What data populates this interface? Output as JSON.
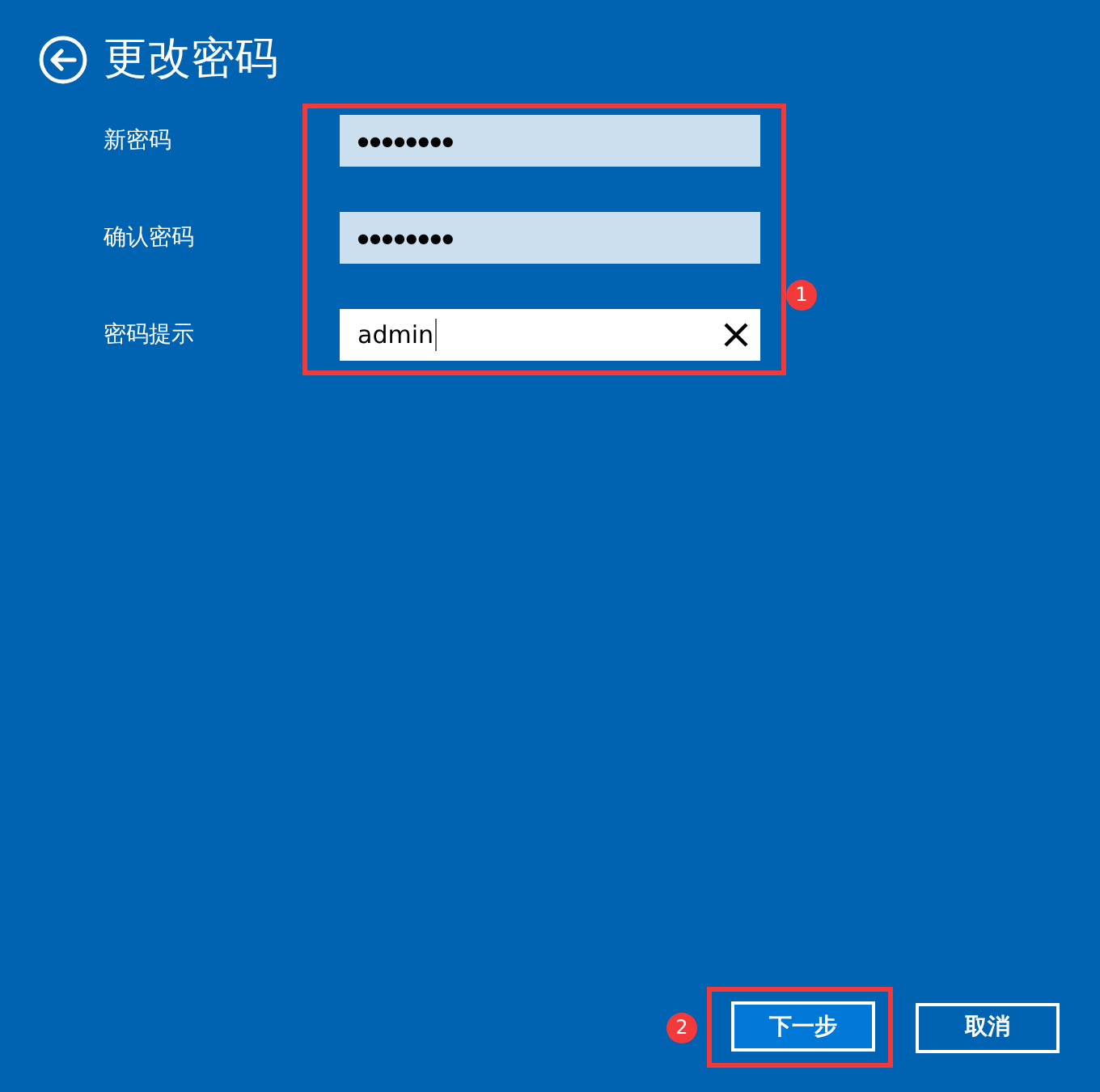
{
  "header": {
    "title": "更改密码"
  },
  "form": {
    "fields_callout": "1",
    "fields": [
      {
        "label": "新密码",
        "kind": "password",
        "value": "●●●●●●●●",
        "focused": false
      },
      {
        "label": "确认密码",
        "kind": "password",
        "value": "●●●●●●●●",
        "focused": false
      },
      {
        "label": "密码提示",
        "kind": "text",
        "value": "admin",
        "focused": true
      }
    ]
  },
  "buttons": [
    {
      "label": "下一步",
      "kind": "primary",
      "callout": "2"
    },
    {
      "label": "取消",
      "kind": "secondary"
    }
  ]
}
